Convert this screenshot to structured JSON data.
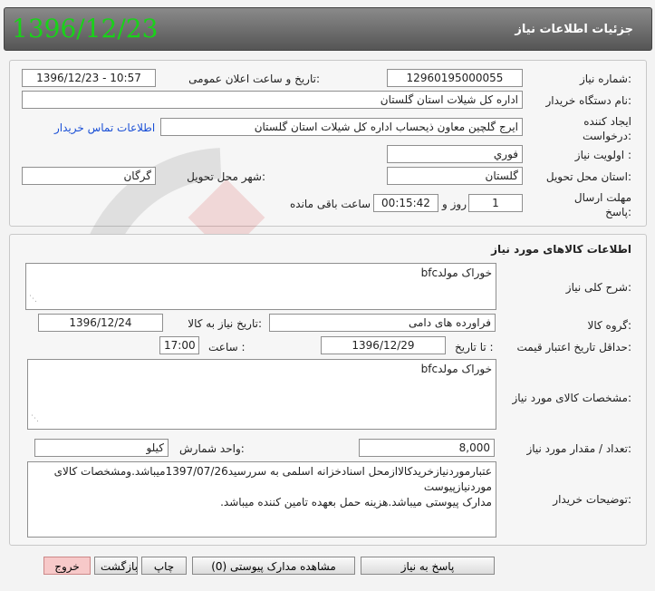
{
  "header": {
    "title": "جزئيات اطلاعات نياز",
    "date": "1396/12/23"
  },
  "info": {
    "need_number_label": "شماره نياز:",
    "need_number": "12960195000055",
    "announce_label": "تاريخ و ساعت اعلان عمومی:",
    "announce_value": "1396/12/23 - 10:57",
    "buyer_org_label": "نام دستگاه خريدار:",
    "buyer_org": "اداره کل شیلات استان گلستان",
    "requester_label": "ايجاد کننده درخواست:",
    "requester": "ایرج گلچین معاون ذیحساب اداره کل شیلات استان گلستان",
    "contact_link": "اطلاعات تماس خريدار",
    "priority_label": "اولويت نياز :",
    "priority": "فوري",
    "province_label": "استان محل تحويل:",
    "province": "گلستان",
    "city_label": "شهر محل تحويل:",
    "city": "گرگان",
    "deadline_label": "مهلت ارسال پاسخ:",
    "days": "1",
    "days_label": "روز و",
    "time_remaining": "00:15:42",
    "time_label": "ساعت باقی مانده"
  },
  "goods": {
    "section_title": "اطلاعات کالاهای مورد نياز",
    "general_desc_label": "شرح کلی نياز:",
    "general_desc": "خوراک مولدbfc",
    "group_label": "گروه کالا:",
    "group": "فراورده های دامی",
    "need_date_label": "تاريخ نياز به کالا:",
    "need_date": "1396/12/24",
    "price_validity_label": "حداقل تاريخ اعتبار قيمت:",
    "until_label": "تا تاريخ :",
    "validity_date": "1396/12/29",
    "hour_label": "ساعت :",
    "validity_time": "17:00",
    "specs_label": "مشخصات کالای مورد نياز:",
    "specs": "خوراک مولدbfc",
    "qty_label": "تعداد / مقدار مورد نياز:",
    "qty": "8,000",
    "unit_label": "واحد شمارش:",
    "unit": "کیلو",
    "buyer_notes_label": "توضيحات خريدار:",
    "buyer_notes_line1": "عتبارموردنیازخریدکالاازمحل اسنادخزانه اسلمی به سررسید1397/07/26میباشد.ومشخصات کالای",
    "buyer_notes_line2": "موردنیازپیوست",
    "buyer_notes_line3": "مدارک پیوستی میباشد.هزینه حمل بعهده تامین کننده میباشد."
  },
  "buttons": {
    "reply": "پاسخ به نياز",
    "attachments": "مشاهده مدارک پيوستی (0)",
    "print": "چاپ",
    "back": "بازگشت",
    "exit": "خروج"
  }
}
